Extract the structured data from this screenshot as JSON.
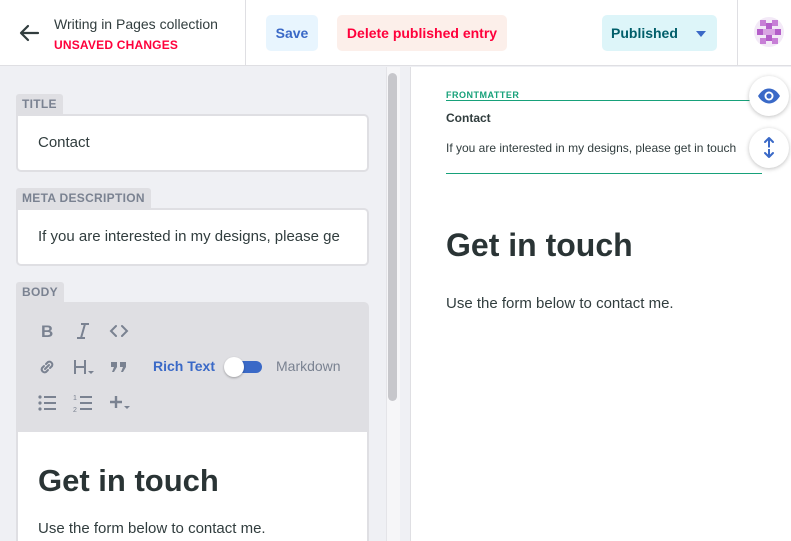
{
  "header": {
    "back_title": "Writing in Pages collection",
    "status": "UNSAVED CHANGES",
    "save_label": "Save",
    "delete_label": "Delete published entry",
    "publish_label": "Published"
  },
  "fields": {
    "title": {
      "label": "TITLE",
      "value": "Contact"
    },
    "meta": {
      "label": "META DESCRIPTION",
      "value": "If you are interested in my designs, please ge"
    },
    "body": {
      "label": "BODY",
      "rich_label": "Rich Text",
      "markdown_label": "Markdown",
      "heading": "Get in touch",
      "paragraph": "Use the form below to contact me."
    }
  },
  "preview": {
    "frontmatter_label": "FRONTMATTER",
    "title": "Contact",
    "description": "If you are interested in my designs, please get in touch",
    "heading": "Get in touch",
    "paragraph": "Use the form below to contact me."
  },
  "colors": {
    "accent": "#3a69c7",
    "danger": "#ff003b",
    "frontmatter": "#17a17a"
  }
}
